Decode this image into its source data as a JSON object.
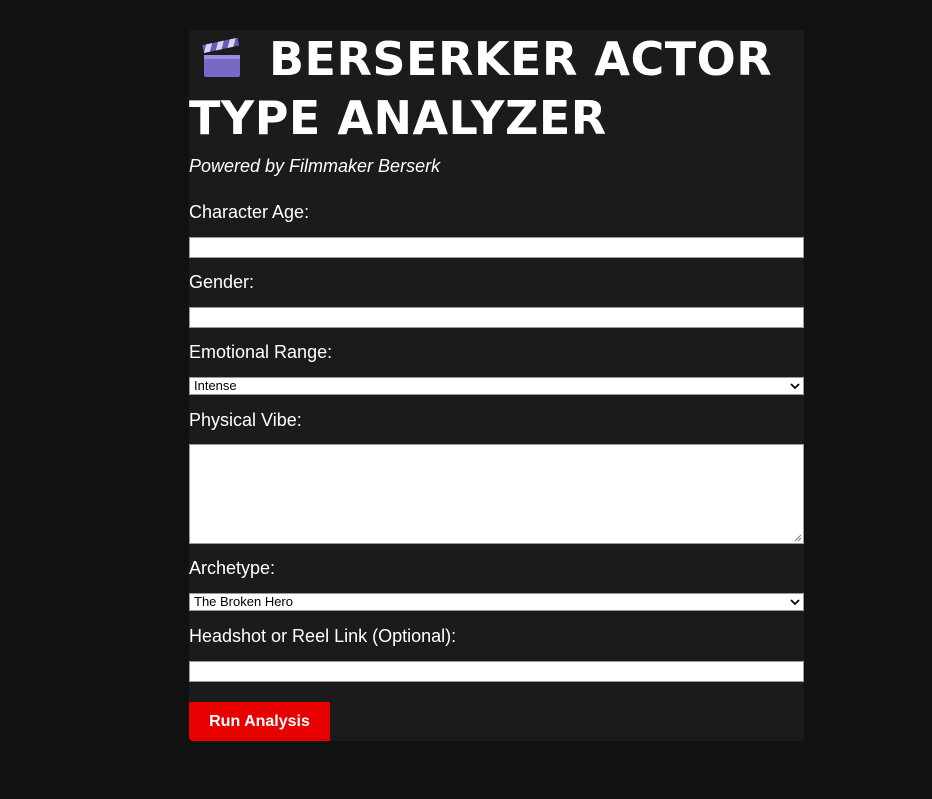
{
  "header": {
    "title_line1": "BERSERKER ACTOR",
    "title_line2": "TYPE ANALYZER",
    "title_icon": "clapperboard-icon",
    "subtitle": "Powered by Filmmaker Berserk"
  },
  "form": {
    "age_label": "Character Age:",
    "age_value": "",
    "gender_label": "Gender:",
    "gender_value": "",
    "emotional_range_label": "Emotional Range:",
    "emotional_range_value": "Intense",
    "physical_vibe_label": "Physical Vibe:",
    "physical_vibe_value": "",
    "archetype_label": "Archetype:",
    "archetype_value": "The Broken Hero",
    "headshot_label": "Headshot or Reel Link (Optional):",
    "headshot_value": "",
    "submit_label": "Run Analysis"
  },
  "colors": {
    "page_bg": "#111111",
    "card_bg": "#1b1b1b",
    "accent": "#e60000",
    "text": "#ffffff"
  }
}
